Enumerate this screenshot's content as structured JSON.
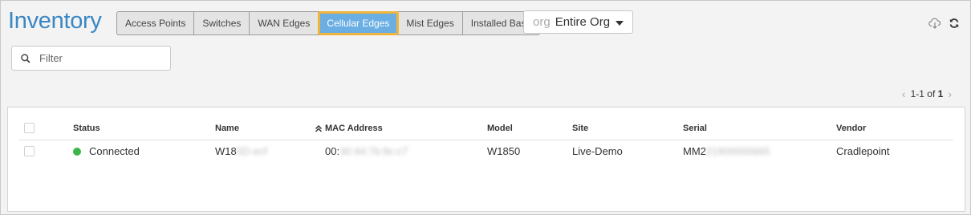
{
  "header": {
    "title": "Inventory",
    "tabs": [
      {
        "label": "Access Points",
        "active": false
      },
      {
        "label": "Switches",
        "active": false
      },
      {
        "label": "WAN Edges",
        "active": false
      },
      {
        "label": "Cellular Edges",
        "active": true
      },
      {
        "label": "Mist Edges",
        "active": false
      },
      {
        "label": "Installed Base",
        "active": false
      }
    ],
    "org_select": {
      "prefix": "org",
      "value": "Entire Org"
    },
    "icons": [
      "cloud-download-icon",
      "refresh-icon"
    ]
  },
  "filter": {
    "placeholder": "Filter",
    "value": ""
  },
  "pagination": {
    "range": "1-1",
    "of_label": "of",
    "total": "1"
  },
  "table": {
    "columns": [
      "Status",
      "Name",
      "MAC Address",
      "Model",
      "Site",
      "Serial",
      "Vendor"
    ],
    "sorted_column": "MAC Address",
    "rows": [
      {
        "status": "Connected",
        "name_visible": "W18",
        "name_blurred": "5D-ecf",
        "mac_visible": "00:",
        "mac_blurred": "30:44:7b:9c:c7",
        "model": "W1850",
        "site": "Live-Demo",
        "serial_visible": "MM2",
        "serial_blurred": "21900000665",
        "vendor": "Cradlepoint"
      }
    ]
  },
  "colors": {
    "accent": "#3b87c4",
    "active_tab": "#6aaee3",
    "active_outline": "#f0b43c",
    "connected": "#3bb54a"
  }
}
